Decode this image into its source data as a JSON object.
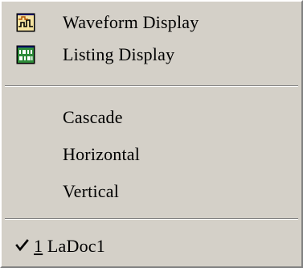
{
  "menu": {
    "items": [
      {
        "label": "Waveform Display",
        "icon": "waveform-icon"
      },
      {
        "label": "Listing Display",
        "icon": "listing-icon"
      },
      {
        "label": "Cascade"
      },
      {
        "label": "Horizontal"
      },
      {
        "label": "Vertical"
      }
    ],
    "window_item": {
      "accel": "1",
      "label": " LaDoc1",
      "checked": true,
      "check_icon": "checkmark-icon"
    }
  },
  "colors": {
    "menu_bg": "#d4d0c8",
    "icon_wave_bg": "#f5e3a0",
    "icon_listing_bg": "#2e8b3a"
  }
}
